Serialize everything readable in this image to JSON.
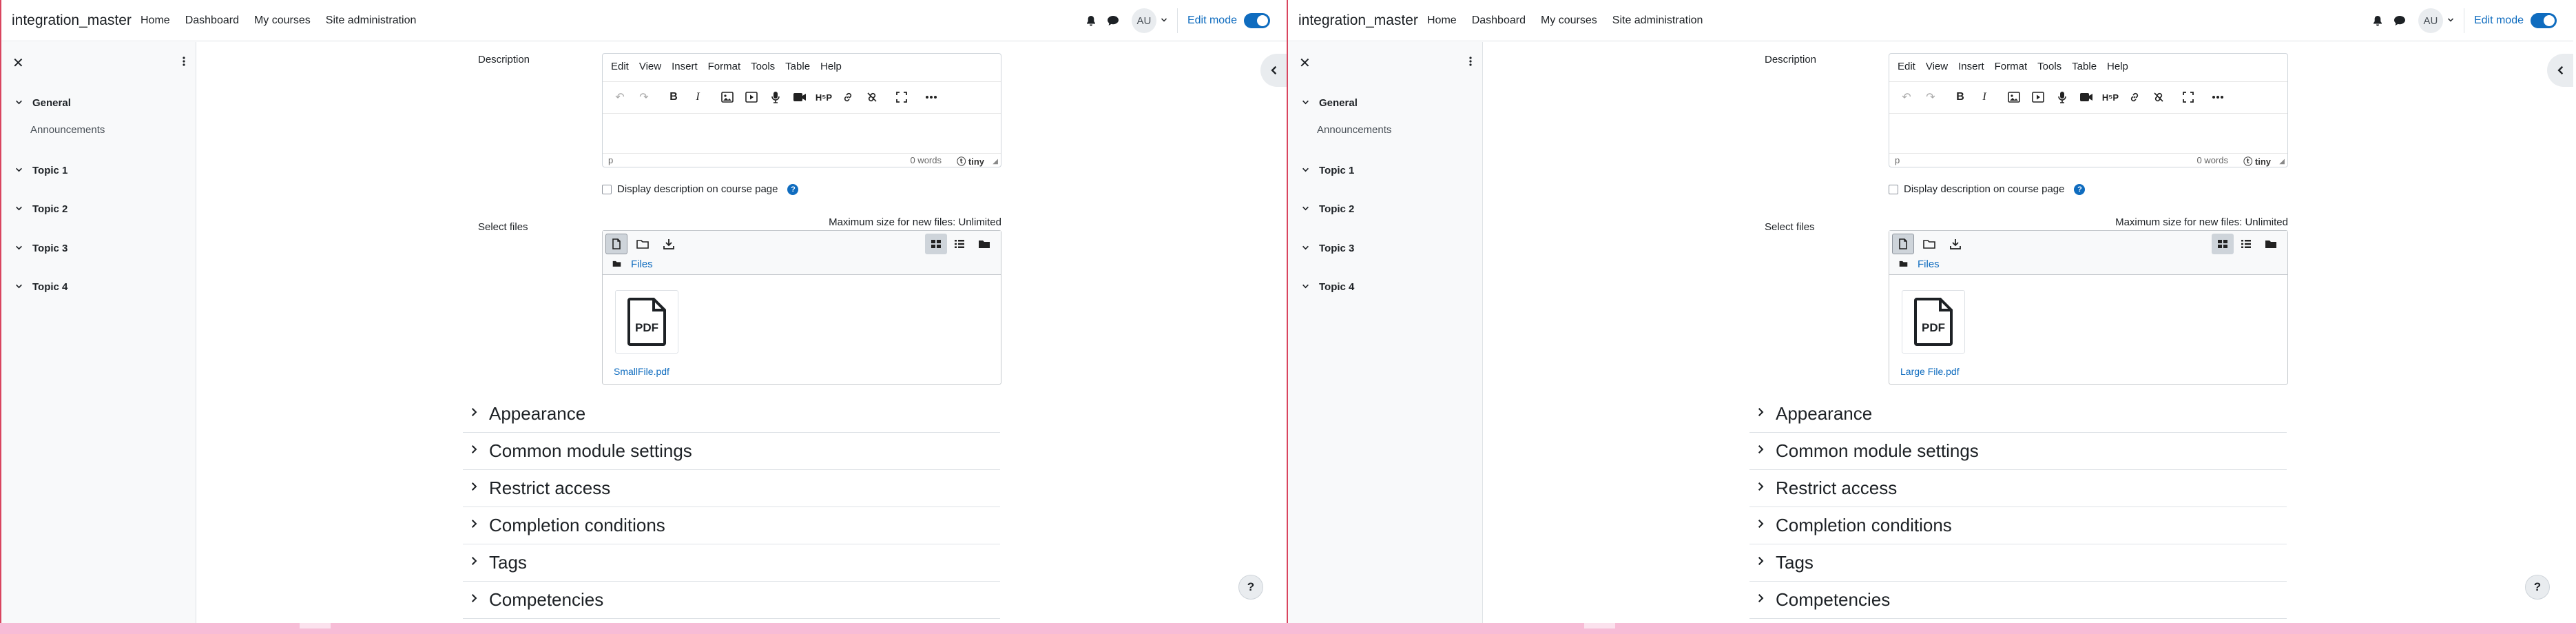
{
  "panes": [
    {
      "navbar": {
        "brand": "integration_master",
        "links": [
          "Home",
          "Dashboard",
          "My courses",
          "Site administration"
        ],
        "avatar": "AU",
        "edit_mode_label": "Edit mode"
      },
      "drawer": {
        "items": [
          {
            "label": "General"
          },
          {
            "label": "Topic 1"
          },
          {
            "label": "Topic 2"
          },
          {
            "label": "Topic 3"
          },
          {
            "label": "Topic 4"
          }
        ],
        "subitem": "Announcements"
      },
      "form": {
        "description_label": "Description",
        "editor_menu": [
          "Edit",
          "View",
          "Insert",
          "Format",
          "Tools",
          "Table",
          "Help"
        ],
        "editor_status_path": "p",
        "editor_word_count": "0 words",
        "editor_brand": "tiny",
        "display_description_label": "Display description on course page",
        "select_files_label": "Select files",
        "max_size_text": "Maximum size for new files: Unlimited",
        "files_link": "Files",
        "file_name": "SmallFile.pdf",
        "file_icon_text": "PDF",
        "sections": [
          "Appearance",
          "Common module settings",
          "Restrict access",
          "Completion conditions",
          "Tags",
          "Competencies"
        ]
      },
      "help_button": "?"
    },
    {
      "navbar": {
        "brand": "integration_master",
        "links": [
          "Home",
          "Dashboard",
          "My courses",
          "Site administration"
        ],
        "avatar": "AU",
        "edit_mode_label": "Edit mode"
      },
      "drawer": {
        "items": [
          {
            "label": "General"
          },
          {
            "label": "Topic 1"
          },
          {
            "label": "Topic 2"
          },
          {
            "label": "Topic 3"
          },
          {
            "label": "Topic 4"
          }
        ],
        "subitem": "Announcements"
      },
      "form": {
        "description_label": "Description",
        "editor_menu": [
          "Edit",
          "View",
          "Insert",
          "Format",
          "Tools",
          "Table",
          "Help"
        ],
        "editor_status_path": "p",
        "editor_word_count": "0 words",
        "editor_brand": "tiny",
        "display_description_label": "Display description on course page",
        "select_files_label": "Select files",
        "max_size_text": "Maximum size for new files: Unlimited",
        "files_link": "Files",
        "file_name": "Large File.pdf",
        "file_icon_text": "PDF",
        "sections": [
          "Appearance",
          "Common module settings",
          "Restrict access",
          "Completion conditions",
          "Tags",
          "Competencies"
        ]
      },
      "help_button": "?"
    }
  ],
  "colors": {
    "accent": "#0f6cbf",
    "divider": "#d9455f",
    "bottom_strip": "#f7bcd6"
  },
  "icons": [
    "close-icon",
    "kebab-icon",
    "chevron-down-icon",
    "chevron-right-icon",
    "bell-icon",
    "chat-icon",
    "undo-icon",
    "redo-icon",
    "bold-icon",
    "italic-icon",
    "image-icon",
    "media-icon",
    "microphone-icon",
    "video-icon",
    "h5p-icon",
    "link-icon",
    "unlink-icon",
    "fullscreen-icon",
    "more-icon",
    "add-file-icon",
    "create-folder-icon",
    "download-icon",
    "grid-view-icon",
    "list-view-icon",
    "tree-view-icon",
    "folder-icon",
    "pdf-file-icon",
    "drawer-toggle-icon",
    "help-icon"
  ]
}
